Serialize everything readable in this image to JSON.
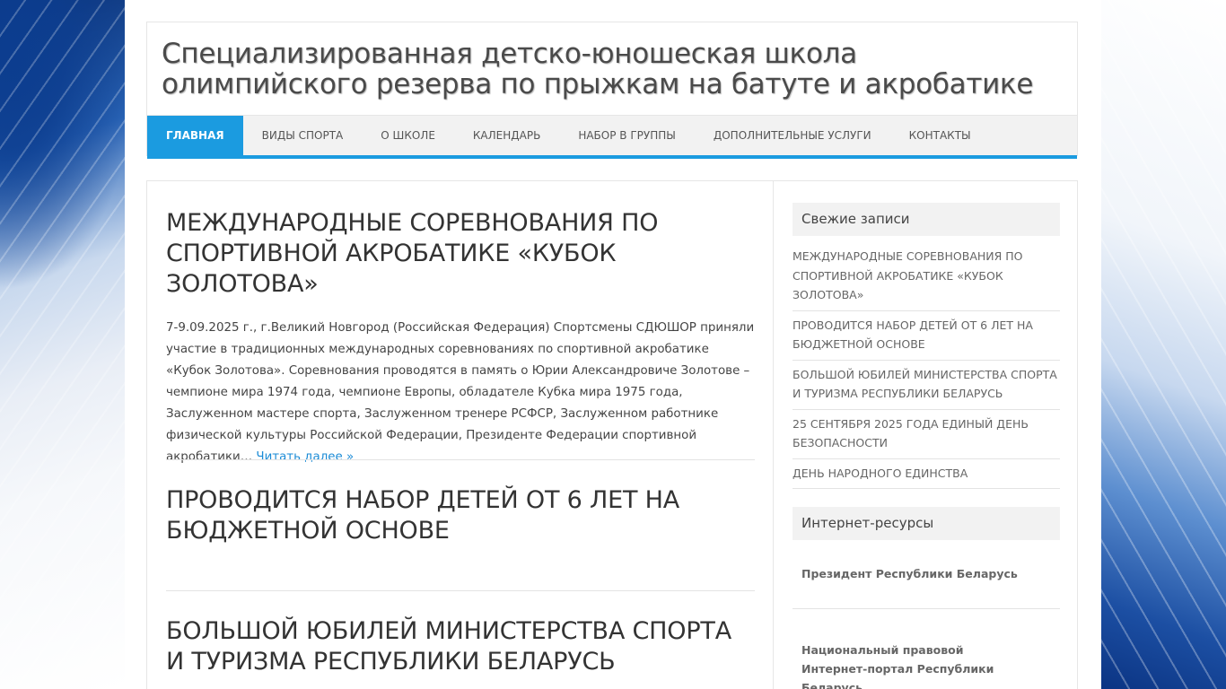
{
  "site": {
    "title_line1": "Специализированная детско-юношеская школа",
    "title_line2": "олимпийского резерва по прыжкам на батуте и акробатике"
  },
  "nav": {
    "items": [
      {
        "label": "Главная",
        "active": true
      },
      {
        "label": "Виды спорта",
        "active": false
      },
      {
        "label": "О школе",
        "active": false
      },
      {
        "label": "Календарь",
        "active": false
      },
      {
        "label": "Набор в группы",
        "active": false
      },
      {
        "label": "Дополнительные услуги",
        "active": false
      },
      {
        "label": "Контакты",
        "active": false
      }
    ],
    "accent_color": "#1b9be0"
  },
  "posts": [
    {
      "title": "Международные соревнования по спортивной акробатике «Кубок Золотова»",
      "excerpt": "7-9.09.2025 г., г.Великий Новгород (Российская Федерация) Спортсмены СДЮШОР приняли участие в традиционных международных соревнованиях по спортивной акробатике «Кубок Золотова». Соревнования проводятся в память о Юрии Александровиче Золотове – чемпионе мира 1974 года, чемпионе Европы, обладателе Кубка мира 1975 года, Заслуженном мастере спорта, Заслуженном тренере РСФСР, Заслуженном работнике физической культуры Российской Федерации, Президенте Федерации спортивной акробатики…",
      "read_more": "Читать далее »"
    },
    {
      "title": "Проводится набор детей от 6 лет на бюджетной основе"
    },
    {
      "title": "Большой юбилей Министерства спорта и туризма Республики Беларусь"
    }
  ],
  "sidebar": {
    "recent": {
      "title": "Свежие записи",
      "items": [
        "Международные соревнования по спортивной акробатике «Кубок Золотова»",
        "Проводится набор детей от 6 лет на бюджетной основе",
        "Большой юбилей Министерства спорта и туризма Республики Беларусь",
        "25 сентября 2025 года Единый день безопасности",
        "День народного единства"
      ]
    },
    "resources": {
      "title": "Интернет-ресурсы",
      "items": [
        "Президент Республики Беларусь",
        "Национальный правовой Интернет-портал Республики Беларусь"
      ]
    }
  }
}
